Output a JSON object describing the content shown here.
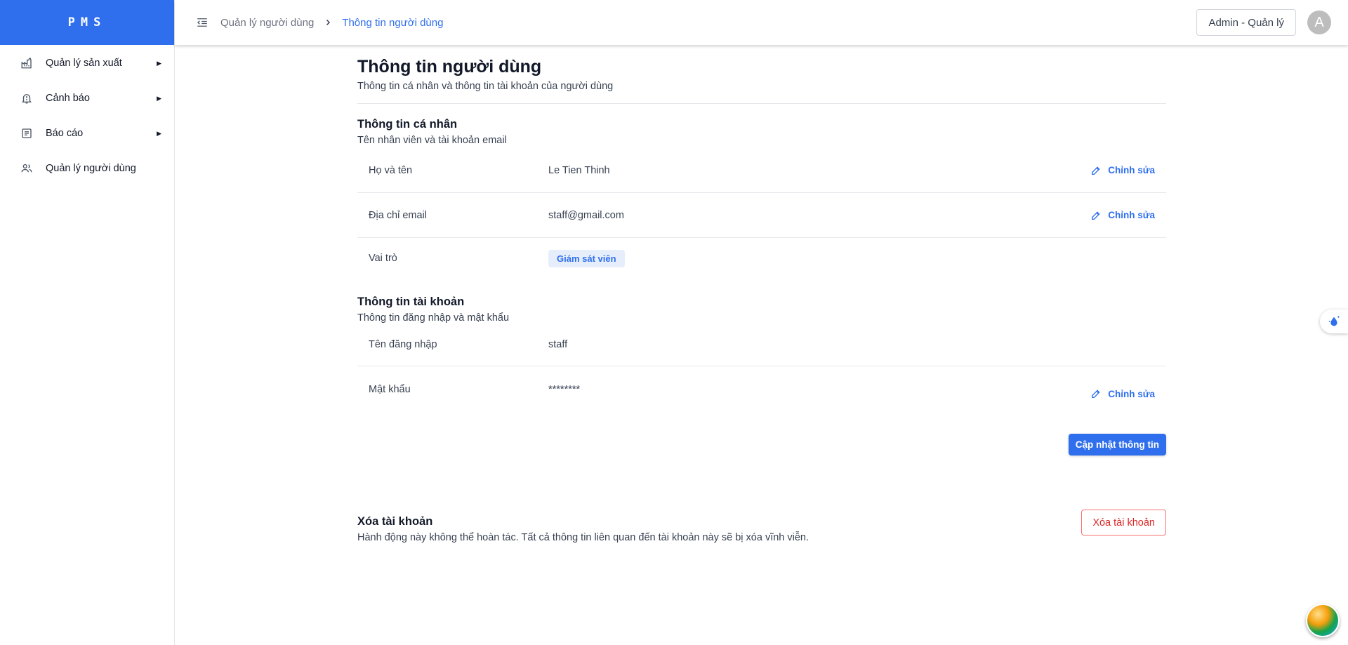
{
  "app": {
    "logo": "PMS"
  },
  "sidebar": {
    "items": [
      {
        "label": "Quản lý sản xuất",
        "icon": "factory-icon",
        "has_children": true
      },
      {
        "label": "Cảnh báo",
        "icon": "bell-alert-icon",
        "has_children": true
      },
      {
        "label": "Báo cáo",
        "icon": "report-icon",
        "has_children": true
      },
      {
        "label": "Quản lý người dùng",
        "icon": "users-icon",
        "has_children": false
      }
    ]
  },
  "header": {
    "breadcrumb": [
      "Quản lý người dùng",
      "Thông tin người dùng"
    ],
    "role_button": "Admin - Quản lý",
    "avatar_initial": "A"
  },
  "page": {
    "title": "Thông tin người dùng",
    "subtitle": "Thông tin cá nhân và thông tin tài khoản của người dùng"
  },
  "personal": {
    "title": "Thông tin cá nhân",
    "subtitle": "Tên nhân viên và tài khoản email",
    "fullname_label": "Họ và tên",
    "fullname_value": "Le Tien Thinh",
    "email_label": "Địa chỉ email",
    "email_value": "staff@gmail.com",
    "role_label": "Vai trò",
    "role_value": "Giám sát viên",
    "edit_label": "Chỉnh sửa"
  },
  "account": {
    "title": "Thông tin tài khoản",
    "subtitle": "Thông tin đăng nhập và mật khẩu",
    "username_label": "Tên đăng nhập",
    "username_value": "staff",
    "password_label": "Mật khẩu",
    "password_value": "********",
    "edit_label": "Chỉnh sửa"
  },
  "actions": {
    "update_label": "Cập nhật thông tin"
  },
  "danger": {
    "title": "Xóa tài khoản",
    "description": "Hành động này không thể hoàn tác. Tất cả thông tin liên quan đến tài khoản này sẽ bị xóa vĩnh viễn.",
    "button_label": "Xóa tài khoản"
  },
  "colors": {
    "primary": "#2f6fed",
    "danger": "#dc2626",
    "badge_bg": "#e6eefc"
  }
}
